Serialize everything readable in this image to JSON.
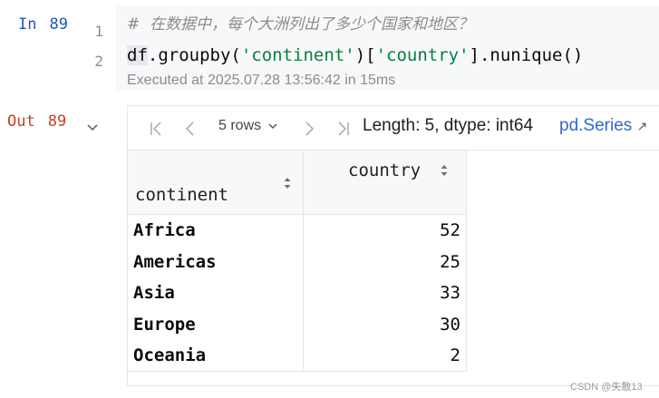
{
  "input_cell": {
    "prompt_word": "In",
    "exec_count": "89",
    "line_numbers": [
      "1",
      "2"
    ],
    "comment": "#  在数据中，每个大洲列出了多少个国家和地区？",
    "code": {
      "var": "df",
      "part1": ".groupby(",
      "str1": "'continent'",
      "part2": ")[",
      "str2": "'country'",
      "part3": "].nunique()"
    },
    "exec_info": "Executed at 2025.07.28 13:56:42 in 15ms"
  },
  "output_cell": {
    "prompt_word": "Out",
    "exec_count": "89",
    "toolbar": {
      "rows_label": "5 rows",
      "info": "Length: 5, dtype: int64",
      "type_link": "pd.Series",
      "type_link_arrow": "↗"
    },
    "table": {
      "index_header": "continent",
      "value_header": "country",
      "rows": [
        {
          "key": "Africa",
          "value": "52"
        },
        {
          "key": "Americas",
          "value": "25"
        },
        {
          "key": "Asia",
          "value": "33"
        },
        {
          "key": "Europe",
          "value": "30"
        },
        {
          "key": "Oceania",
          "value": "2"
        }
      ]
    }
  },
  "watermark": "CSDN @失散13",
  "colors": {
    "in_prompt": "#1f57b5",
    "out_prompt": "#c4401e",
    "string": "#087f3a",
    "link": "#2f6ad6",
    "code_bg": "#f7f8fa"
  },
  "icons": [
    "first-page-icon",
    "prev-page-icon",
    "chevron-down-icon",
    "next-page-icon",
    "last-page-icon",
    "external-link-icon",
    "sort-icon",
    "collapse-chevron-icon"
  ]
}
